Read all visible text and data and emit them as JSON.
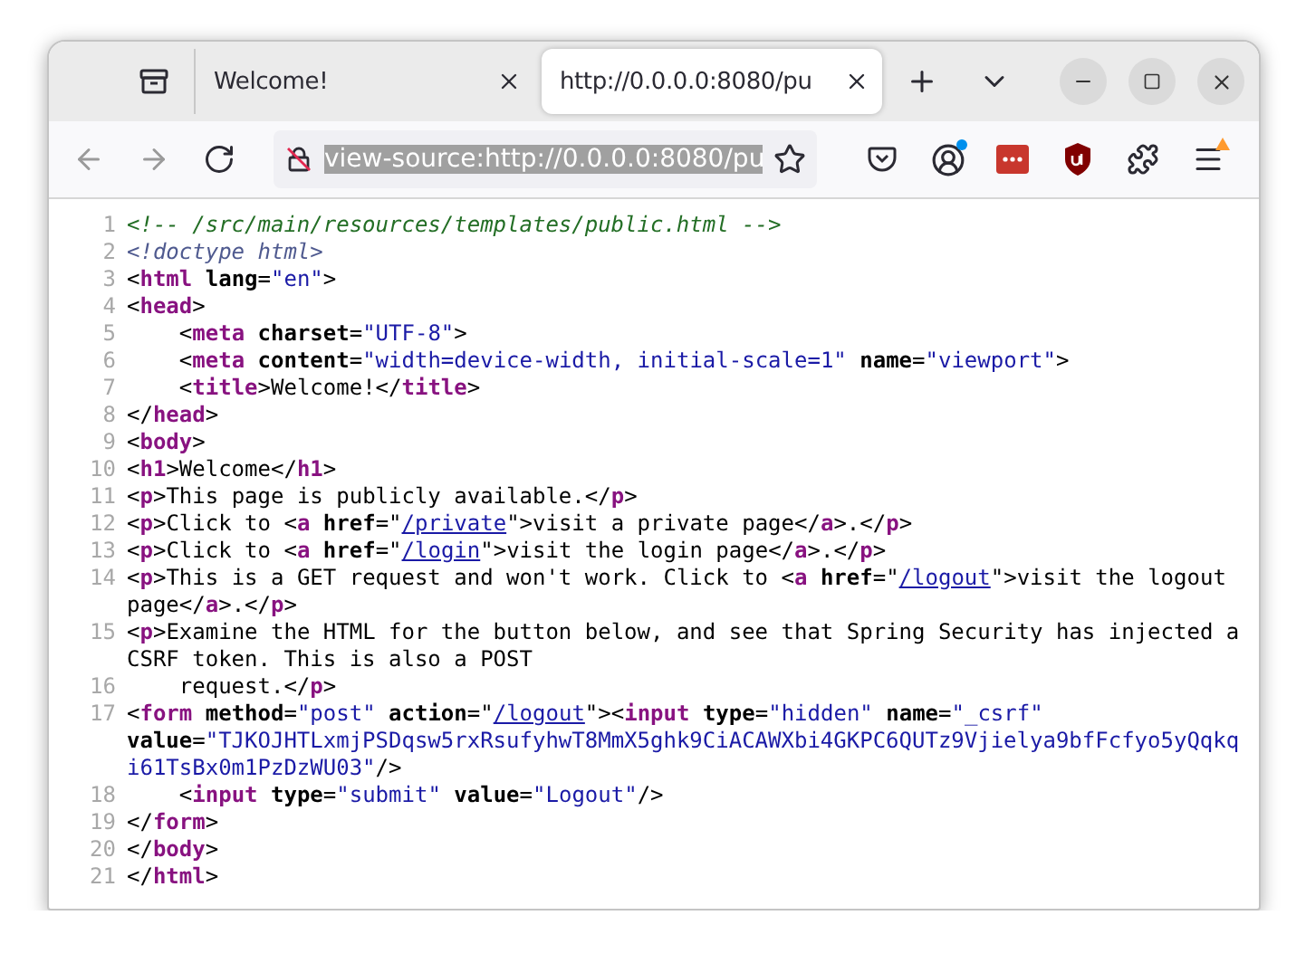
{
  "window": {
    "tabs": [
      {
        "title": "Welcome!",
        "selected": false
      },
      {
        "title": "http://0.0.0.0:8080/pu",
        "selected": true
      }
    ]
  },
  "toolbar": {
    "nav": [
      {
        "kind": "back",
        "disabled": true
      },
      {
        "kind": "forward",
        "disabled": true
      },
      {
        "kind": "reload",
        "disabled": false
      }
    ],
    "address": "view-source:http://0.0.0.0:8080/pu"
  },
  "source": {
    "lines": [
      {
        "number": "1",
        "tokens": [
          {
            "kind": "comment",
            "text": "<!-- /src/main/resources/templates/public.html -->"
          }
        ]
      },
      {
        "number": "2",
        "tokens": [
          {
            "kind": "doctype",
            "text": "<!doctype html>"
          }
        ]
      },
      {
        "number": "3",
        "tokens": [
          {
            "kind": "text",
            "text": "<"
          },
          {
            "kind": "tag",
            "text": "html"
          },
          {
            "kind": "attr",
            "text": " lang"
          },
          {
            "kind": "text",
            "text": "="
          },
          {
            "kind": "value",
            "text": "\"en\""
          },
          {
            "kind": "text",
            "text": ">"
          }
        ]
      },
      {
        "number": "4",
        "tokens": [
          {
            "kind": "text",
            "text": "<"
          },
          {
            "kind": "tag",
            "text": "head"
          },
          {
            "kind": "text",
            "text": ">"
          }
        ]
      },
      {
        "number": "5",
        "tokens": [
          {
            "kind": "text",
            "text": "    <"
          },
          {
            "kind": "tag",
            "text": "meta"
          },
          {
            "kind": "attr",
            "text": " charset"
          },
          {
            "kind": "text",
            "text": "="
          },
          {
            "kind": "value",
            "text": "\"UTF-8\""
          },
          {
            "kind": "text",
            "text": ">"
          }
        ]
      },
      {
        "number": "6",
        "tokens": [
          {
            "kind": "text",
            "text": "    <"
          },
          {
            "kind": "tag",
            "text": "meta"
          },
          {
            "kind": "attr",
            "text": " content"
          },
          {
            "kind": "text",
            "text": "="
          },
          {
            "kind": "value",
            "text": "\"width=device-width, initial-scale=1\""
          },
          {
            "kind": "attr",
            "text": " name"
          },
          {
            "kind": "text",
            "text": "="
          },
          {
            "kind": "value",
            "text": "\"viewport\""
          },
          {
            "kind": "text",
            "text": ">"
          }
        ]
      },
      {
        "number": "7",
        "tokens": [
          {
            "kind": "text",
            "text": "    <"
          },
          {
            "kind": "tag",
            "text": "title"
          },
          {
            "kind": "text",
            "text": ">Welcome!</"
          },
          {
            "kind": "tag",
            "text": "title"
          },
          {
            "kind": "text",
            "text": ">"
          }
        ]
      },
      {
        "number": "8",
        "tokens": [
          {
            "kind": "text",
            "text": "</"
          },
          {
            "kind": "tag",
            "text": "head"
          },
          {
            "kind": "text",
            "text": ">"
          }
        ]
      },
      {
        "number": "9",
        "tokens": [
          {
            "kind": "text",
            "text": "<"
          },
          {
            "kind": "tag",
            "text": "body"
          },
          {
            "kind": "text",
            "text": ">"
          }
        ]
      },
      {
        "number": "10",
        "tokens": [
          {
            "kind": "text",
            "text": "<"
          },
          {
            "kind": "tag",
            "text": "h1"
          },
          {
            "kind": "text",
            "text": ">Welcome</"
          },
          {
            "kind": "tag",
            "text": "h1"
          },
          {
            "kind": "text",
            "text": ">"
          }
        ]
      },
      {
        "number": "11",
        "tokens": [
          {
            "kind": "text",
            "text": "<"
          },
          {
            "kind": "tag",
            "text": "p"
          },
          {
            "kind": "text",
            "text": ">This page is publicly available.</"
          },
          {
            "kind": "tag",
            "text": "p"
          },
          {
            "kind": "text",
            "text": ">"
          }
        ]
      },
      {
        "number": "12",
        "tokens": [
          {
            "kind": "text",
            "text": "<"
          },
          {
            "kind": "tag",
            "text": "p"
          },
          {
            "kind": "text",
            "text": ">Click to <"
          },
          {
            "kind": "tag",
            "text": "a"
          },
          {
            "kind": "attr",
            "text": " href"
          },
          {
            "kind": "text",
            "text": "=\""
          },
          {
            "kind": "link",
            "text": "/private"
          },
          {
            "kind": "text",
            "text": "\">visit a private page</"
          },
          {
            "kind": "tag",
            "text": "a"
          },
          {
            "kind": "text",
            "text": ">.</"
          },
          {
            "kind": "tag",
            "text": "p"
          },
          {
            "kind": "text",
            "text": ">"
          }
        ]
      },
      {
        "number": "13",
        "tokens": [
          {
            "kind": "text",
            "text": "<"
          },
          {
            "kind": "tag",
            "text": "p"
          },
          {
            "kind": "text",
            "text": ">Click to <"
          },
          {
            "kind": "tag",
            "text": "a"
          },
          {
            "kind": "attr",
            "text": " href"
          },
          {
            "kind": "text",
            "text": "=\""
          },
          {
            "kind": "link",
            "text": "/login"
          },
          {
            "kind": "text",
            "text": "\">visit the login page</"
          },
          {
            "kind": "tag",
            "text": "a"
          },
          {
            "kind": "text",
            "text": ">.</"
          },
          {
            "kind": "tag",
            "text": "p"
          },
          {
            "kind": "text",
            "text": ">"
          }
        ]
      },
      {
        "number": "14",
        "tokens": [
          {
            "kind": "text",
            "text": "<"
          },
          {
            "kind": "tag",
            "text": "p"
          },
          {
            "kind": "text",
            "text": ">This is a GET request and won't work. Click to <"
          },
          {
            "kind": "tag",
            "text": "a"
          },
          {
            "kind": "attr",
            "text": " href"
          },
          {
            "kind": "text",
            "text": "=\""
          },
          {
            "kind": "link",
            "text": "/logout"
          },
          {
            "kind": "text",
            "text": "\">visit the logout page</"
          },
          {
            "kind": "tag",
            "text": "a"
          },
          {
            "kind": "text",
            "text": ">.</"
          },
          {
            "kind": "tag",
            "text": "p"
          },
          {
            "kind": "text",
            "text": ">"
          }
        ]
      },
      {
        "number": "15",
        "tokens": [
          {
            "kind": "text",
            "text": "<"
          },
          {
            "kind": "tag",
            "text": "p"
          },
          {
            "kind": "text",
            "text": ">Examine the HTML for the button below, and see that Spring Security has injected a CSRF token. This is also a POST"
          }
        ]
      },
      {
        "number": "16",
        "tokens": [
          {
            "kind": "text",
            "text": "    request.</"
          },
          {
            "kind": "tag",
            "text": "p"
          },
          {
            "kind": "text",
            "text": ">"
          }
        ]
      },
      {
        "number": "17",
        "tokens": [
          {
            "kind": "text",
            "text": "<"
          },
          {
            "kind": "tag",
            "text": "form"
          },
          {
            "kind": "attr",
            "text": " method"
          },
          {
            "kind": "text",
            "text": "="
          },
          {
            "kind": "value",
            "text": "\"post\""
          },
          {
            "kind": "attr",
            "text": " action"
          },
          {
            "kind": "text",
            "text": "=\""
          },
          {
            "kind": "link",
            "text": "/logout"
          },
          {
            "kind": "text",
            "text": "\"><"
          },
          {
            "kind": "tag",
            "text": "input"
          },
          {
            "kind": "attr",
            "text": " type"
          },
          {
            "kind": "text",
            "text": "="
          },
          {
            "kind": "value",
            "text": "\"hidden\""
          },
          {
            "kind": "attr",
            "text": " name"
          },
          {
            "kind": "text",
            "text": "="
          },
          {
            "kind": "value",
            "text": "\"_csrf\""
          },
          {
            "kind": "attr",
            "text": " value"
          },
          {
            "kind": "text",
            "text": "="
          },
          {
            "kind": "value",
            "text": "\"TJKOJHTLxmjPSDqsw5rxRsufyhwT8MmX5ghk9CiACAWXbi4GKPC6QUTz9Vjielya9bfFcfyo5yQqkqi61TsBx0m1PzDzWU03\""
          },
          {
            "kind": "text",
            "text": "/>"
          }
        ]
      },
      {
        "number": "18",
        "tokens": [
          {
            "kind": "text",
            "text": "    <"
          },
          {
            "kind": "tag",
            "text": "input"
          },
          {
            "kind": "attr",
            "text": " type"
          },
          {
            "kind": "text",
            "text": "="
          },
          {
            "kind": "value",
            "text": "\"submit\""
          },
          {
            "kind": "attr",
            "text": " value"
          },
          {
            "kind": "text",
            "text": "="
          },
          {
            "kind": "value",
            "text": "\"Logout\""
          },
          {
            "kind": "text",
            "text": "/>"
          }
        ]
      },
      {
        "number": "19",
        "tokens": [
          {
            "kind": "text",
            "text": "</"
          },
          {
            "kind": "tag",
            "text": "form"
          },
          {
            "kind": "text",
            "text": ">"
          }
        ]
      },
      {
        "number": "20",
        "tokens": [
          {
            "kind": "text",
            "text": "</"
          },
          {
            "kind": "tag",
            "text": "body"
          },
          {
            "kind": "text",
            "text": ">"
          }
        ]
      },
      {
        "number": "21",
        "tokens": [
          {
            "kind": "text",
            "text": "</"
          },
          {
            "kind": "tag",
            "text": "html"
          },
          {
            "kind": "text",
            "text": ">"
          }
        ]
      }
    ]
  }
}
